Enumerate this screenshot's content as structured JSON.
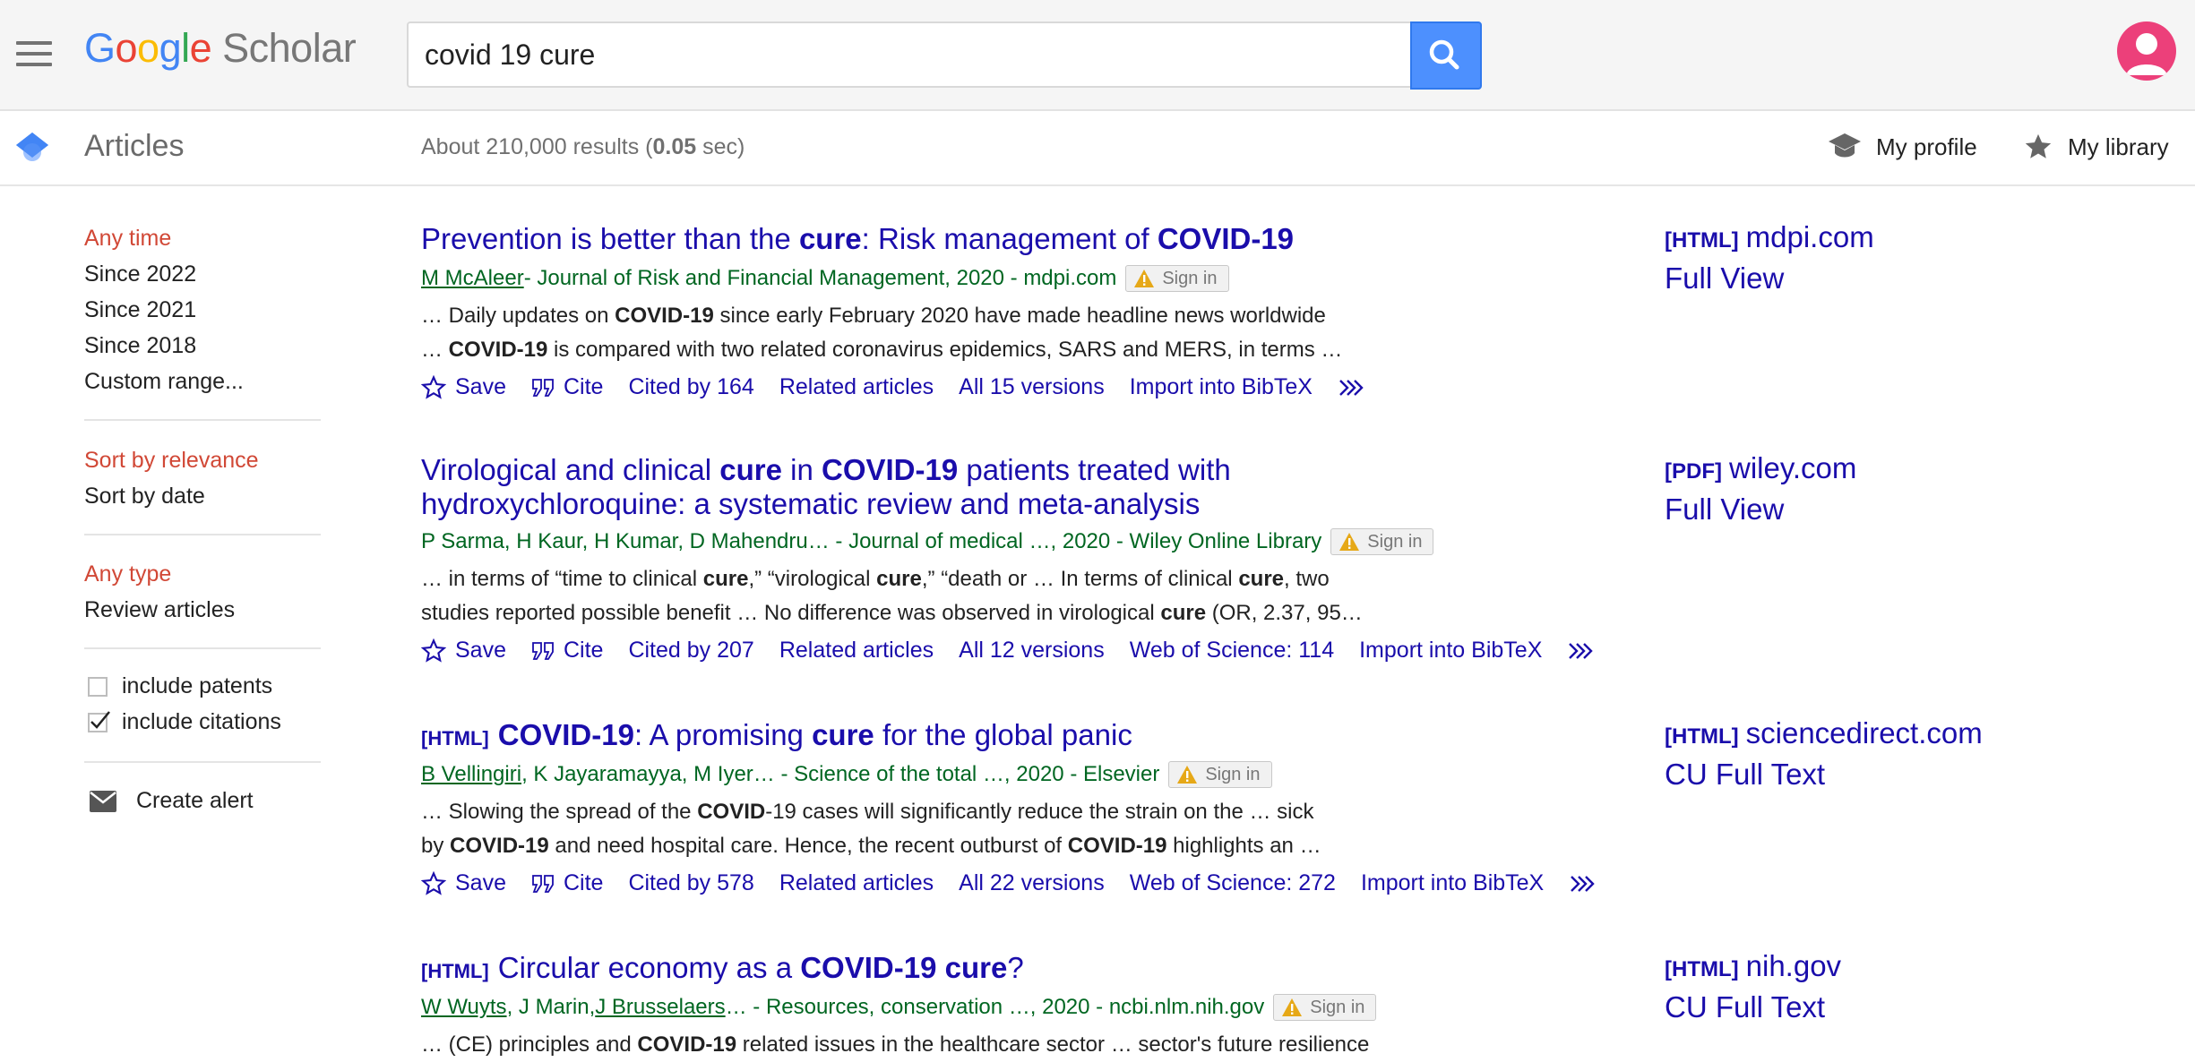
{
  "header": {
    "logo": {
      "g1": "G",
      "g2": "o",
      "g3": "o",
      "g4": "g",
      "g5": "l",
      "g6": "e",
      "scholar": "Scholar"
    },
    "search_value": "covid 19 cure",
    "search_placeholder": ""
  },
  "subbar": {
    "section": "Articles",
    "results_prefix": "About 210,000 results (",
    "results_time": "0.05",
    "results_suffix": " sec)",
    "my_profile": "My profile",
    "my_library": "My library"
  },
  "sidebar": {
    "time": [
      "Any time",
      "Since 2022",
      "Since 2021",
      "Since 2018",
      "Custom range..."
    ],
    "sort": [
      "Sort by relevance",
      "Sort by date"
    ],
    "type": [
      "Any type",
      "Review articles"
    ],
    "include_patents": "include patents",
    "include_citations": "include citations",
    "create_alert": "Create alert"
  },
  "results": [
    {
      "title_parts": [
        "Prevention is better than the ",
        "cure",
        ": Risk management of ",
        "COVID-19"
      ],
      "author_link": "M McAleer",
      "meta": " - Journal of Risk and Financial Management, 2020 - mdpi.com",
      "signin": "Sign in",
      "snippet1": [
        "… Daily updates on ",
        "COVID-19",
        " since early February 2020 have made headline news worldwide"
      ],
      "snippet2": [
        "… ",
        "COVID-19",
        " is compared with two related coronavirus epidemics, SARS and MERS, in terms …"
      ],
      "save": "Save",
      "cite": "Cite",
      "cited_by": "Cited by 164",
      "related": "Related articles",
      "versions": "All 15 versions",
      "wos": "",
      "bibtex": "Import into BibTeX",
      "right_tag": "[HTML]",
      "right_domain": "mdpi.com",
      "right_fv": "Full View"
    },
    {
      "title_line1": [
        "Virological and clinical ",
        "cure",
        " in ",
        "COVID-19",
        " patients treated with"
      ],
      "title_line2": "hydroxychloroquine: a systematic review and meta-analysis",
      "meta": "P Sarma, H Kaur, H Kumar, D Mahendru… - Journal of medical …, 2020 - Wiley Online Library",
      "signin": "Sign in",
      "snippet1": [
        "… in terms of “time to clinical ",
        "cure",
        ",” “virological ",
        "cure",
        ",” “death or … In terms of clinical ",
        "cure",
        ", two"
      ],
      "snippet2": [
        "studies reported possible benefit … No difference was observed in virological ",
        "cure",
        " (OR, 2.37, 95…"
      ],
      "save": "Save",
      "cite": "Cite",
      "cited_by": "Cited by 207",
      "related": "Related articles",
      "versions": "All 12 versions",
      "wos": "Web of Science: 114",
      "bibtex": "Import into BibTeX",
      "right_tag": "[PDF]",
      "right_domain": "wiley.com",
      "right_fv": "Full View"
    },
    {
      "tag": "[HTML]",
      "title_parts": [
        "COVID-19",
        ": A promising ",
        "cure",
        " for the global panic"
      ],
      "author_link": "B Vellingiri",
      "meta": ", K Jayaramayya, M Iyer… - Science of the total …, 2020 - Elsevier",
      "signin": "Sign in",
      "snippet1": [
        "… Slowing the spread of the ",
        "COVID",
        "-19 cases will significantly reduce the strain on the … sick"
      ],
      "snippet2": [
        "by ",
        "COVID-19",
        " and need hospital care. Hence, the recent outburst of ",
        "COVID-19",
        " highlights an …"
      ],
      "save": "Save",
      "cite": "Cite",
      "cited_by": "Cited by 578",
      "related": "Related articles",
      "versions": "All 22 versions",
      "wos": "Web of Science: 272",
      "bibtex": "Import into BibTeX",
      "right_tag": "[HTML]",
      "right_domain": "sciencedirect.com",
      "right_fv": "CU Full Text"
    },
    {
      "tag": "[HTML]",
      "title_parts": [
        "Circular economy as a ",
        "COVID-19 cure",
        "?"
      ],
      "author_link1": "W Wuyts",
      "meta_mid": ", J Marin, ",
      "author_link2": "J Brusselaers",
      "meta": "… - Resources, conservation …, 2020 - ncbi.nlm.nih.gov",
      "signin": "Sign in",
      "snippet1": [
        "… (CE) principles and ",
        "COVID-19",
        " related issues in the healthcare sector … sector's future resilience"
      ],
      "right_tag": "[HTML]",
      "right_domain": "nih.gov",
      "right_fv": "CU Full Text"
    }
  ],
  "colors": {
    "link": "#1a0dab",
    "green": "#006621",
    "active_red": "#d14836",
    "search_blue": "#4d90fe"
  }
}
